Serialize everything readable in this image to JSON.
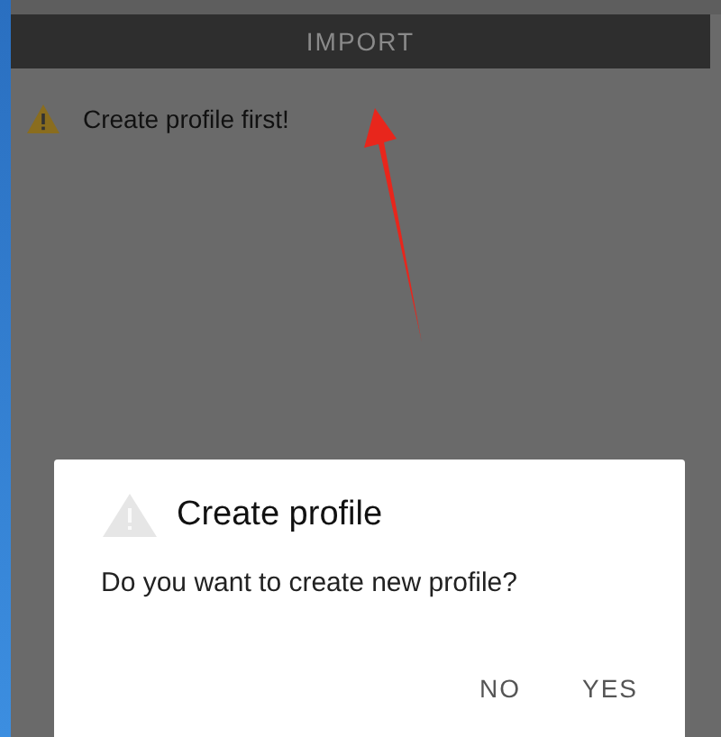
{
  "header": {
    "title": "IMPORT"
  },
  "notice": {
    "text": "Create profile first!"
  },
  "dialog": {
    "title": "Create profile",
    "message": "Do you want to create new profile?",
    "buttons": [
      "NO",
      "YES"
    ]
  }
}
